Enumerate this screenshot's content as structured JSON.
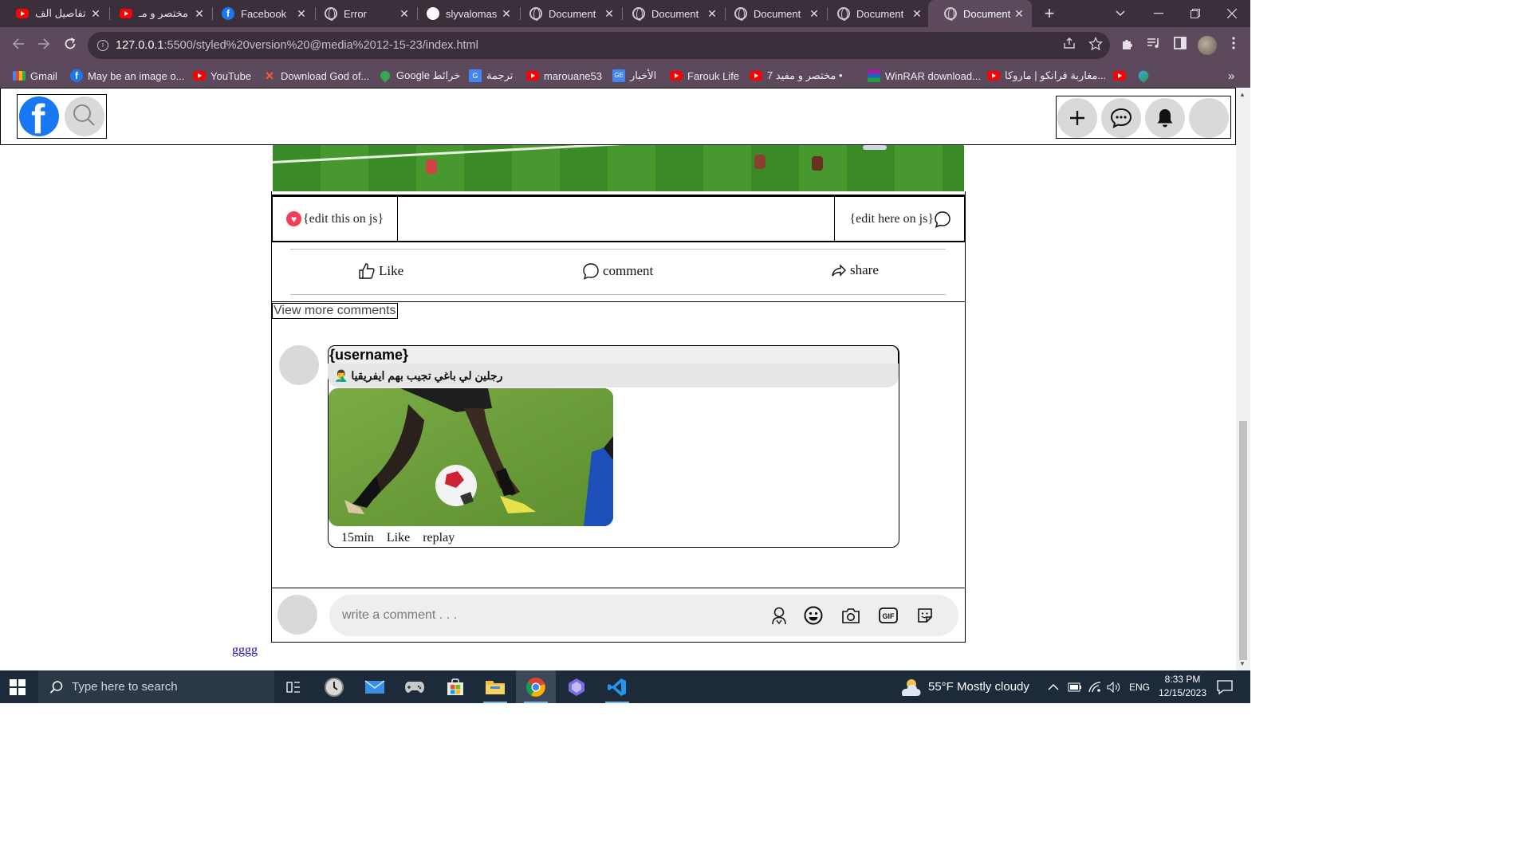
{
  "browser": {
    "tabs": [
      {
        "title": "تفاصيل الف",
        "icon": "youtube-icon"
      },
      {
        "title": "مختصر و مـ",
        "icon": "youtube-icon"
      },
      {
        "title": "Facebook",
        "icon": "facebook-icon"
      },
      {
        "title": "Error",
        "icon": "globe-icon"
      },
      {
        "title": "slyvalomas",
        "icon": "github-icon"
      },
      {
        "title": "Document",
        "icon": "globe-icon"
      },
      {
        "title": "Document",
        "icon": "globe-icon"
      },
      {
        "title": "Document",
        "icon": "globe-icon"
      },
      {
        "title": "Document",
        "icon": "globe-icon"
      },
      {
        "title": "Document",
        "icon": "globe-icon",
        "active": true
      }
    ],
    "close_glyph": "✕",
    "new_tab_glyph": "+",
    "url_host": "127.0.0.1",
    "url_path": ":5500/styled%20version%20@media%2012-15-23/index.html",
    "bookmarks": [
      {
        "label": "Gmail"
      },
      {
        "label": "May be an image o..."
      },
      {
        "label": "YouTube"
      },
      {
        "label": "Download God of..."
      },
      {
        "label": "Google خرائط"
      },
      {
        "label": "ترجمة"
      },
      {
        "label": "marouane53"
      },
      {
        "label": "الأخبار"
      },
      {
        "label": "Farouk Life"
      },
      {
        "label": "مختصر و مفيد 7 •"
      },
      {
        "label": "WinRAR download..."
      },
      {
        "label": "مغاربة فرانكو | ماروكا..."
      }
    ],
    "more_bookmarks_glyph": "»"
  },
  "page": {
    "reaction_left": "{edit this on js}",
    "reaction_right": "{edit here on js}",
    "actions": {
      "like": "Like",
      "comment": "comment",
      "share": "share"
    },
    "view_more": "View more comments",
    "comment": {
      "username": "{username}",
      "text": "رجلين لي باغي تجيب بهم ايفريقيا 🤦‍♂️",
      "time": "15min",
      "like": "Like",
      "reply": "replay"
    },
    "composer_placeholder": "write a comment . . .",
    "footer_link": "gggg"
  },
  "taskbar": {
    "search_placeholder": "Type here to search",
    "weather": "55°F  Mostly cloudy",
    "language": "ENG",
    "time": "8:33 PM",
    "date": "12/15/2023"
  },
  "colors": {
    "chrome_dark": "#3c2f3c",
    "chrome_toolbar": "#5c4a5c",
    "facebook_blue": "#1877f2",
    "heart_red": "#f33e58",
    "taskbar": "#1c2a3a"
  }
}
